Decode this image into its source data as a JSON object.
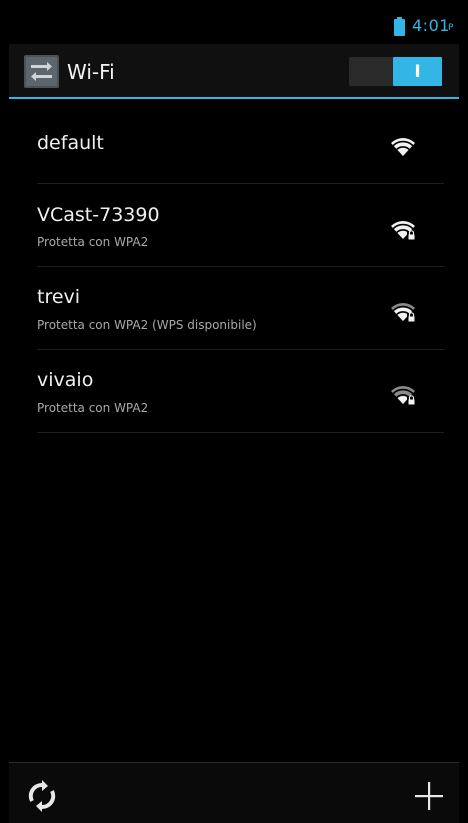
{
  "status_bar": {
    "time": "4:01",
    "ampm": "P",
    "battery_icon": "battery-icon"
  },
  "action_bar": {
    "title": "Wi-Fi",
    "app_icon": "wifi-settings-icon",
    "toggle_label": "I",
    "toggle_state": "on"
  },
  "networks": [
    {
      "ssid": "default",
      "security": "",
      "signal_icon": "wifi-signal-open-icon"
    },
    {
      "ssid": "VCast-73390",
      "security": "Protetta con WPA2",
      "signal_icon": "wifi-signal-locked-icon"
    },
    {
      "ssid": "trevi",
      "security": "Protetta con WPA2 (WPS disponibile)",
      "signal_icon": "wifi-signal-locked-icon"
    },
    {
      "ssid": "vivaio",
      "security": "Protetta con WPA2",
      "signal_icon": "wifi-signal-locked-weak-icon"
    }
  ],
  "bottom_bar": {
    "scan_icon": "refresh-scan-icon",
    "add_icon": "add-network-icon"
  },
  "colors": {
    "accent": "#33b5e5",
    "background": "#000000"
  }
}
